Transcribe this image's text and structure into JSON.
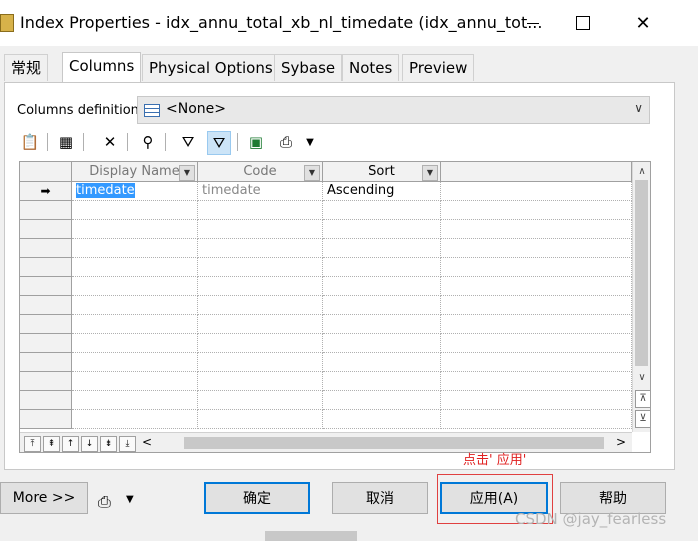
{
  "window": {
    "title": "Index Properties - idx_annu_total_xb_nl_timedate (idx_annu_tot..."
  },
  "tabs": [
    {
      "label": "常规"
    },
    {
      "label": "Columns",
      "active": true
    },
    {
      "label": "Physical Options"
    },
    {
      "label": "Sybase"
    },
    {
      "label": "Notes"
    },
    {
      "label": "Preview"
    }
  ],
  "columns_definition": {
    "label": "Columns definition:",
    "value": "<None>"
  },
  "toolbar_icons": [
    "properties-icon",
    "add-columns-icon",
    "delete-icon",
    "find-icon",
    "filter-icon",
    "filter-toggle-icon",
    "excel-export-icon",
    "print-icon",
    "chevron-down-icon"
  ],
  "grid": {
    "headers": [
      "Display Name",
      "Code",
      "Sort"
    ],
    "rows": [
      {
        "display_name": "timedate",
        "code": "timedate",
        "sort": "Ascending"
      }
    ]
  },
  "note": "点击' 应用'",
  "buttons": {
    "more": "More >>",
    "ok": "确定",
    "cancel": "取消",
    "apply": "应用(A)",
    "help": "帮助"
  },
  "watermark": "CSDN @jay_fearless",
  "colors": {
    "selection": "#3399ff",
    "default_button_border": "#0078d7",
    "annotation": "#e02020"
  }
}
